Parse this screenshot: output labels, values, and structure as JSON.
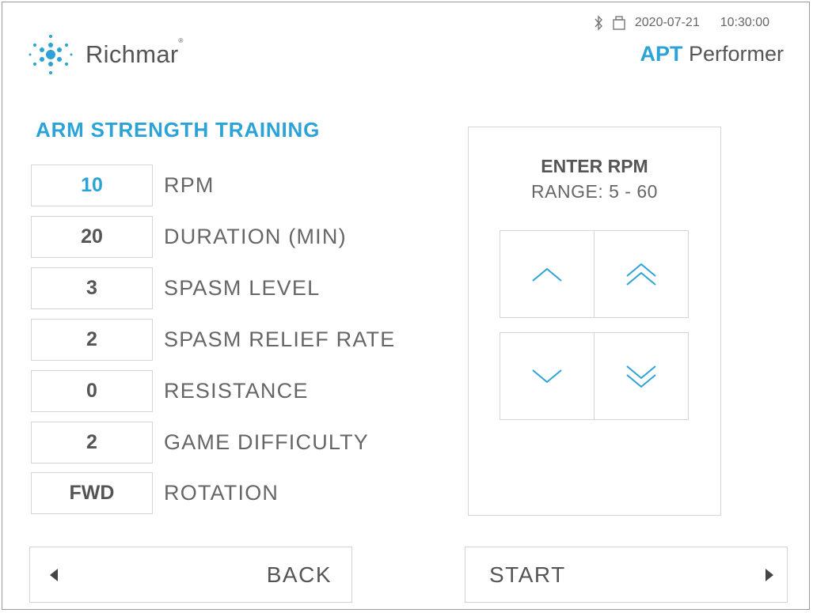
{
  "header": {
    "brand_name": "Richmar",
    "brand_mark": "®",
    "date": "2020-07-21",
    "time": "10:30:00",
    "product_prefix": "APT",
    "product_name": "Performer",
    "status_icons": [
      "bluetooth-icon",
      "usb-drive-icon"
    ]
  },
  "program": {
    "title": "ARM STRENGTH TRAINING",
    "params": [
      {
        "value": "10",
        "label": "RPM",
        "active": true
      },
      {
        "value": "20",
        "label": "DURATION (MIN)"
      },
      {
        "value": "3",
        "label": "SPASM LEVEL"
      },
      {
        "value": "2",
        "label": "SPASM RELIEF RATE"
      },
      {
        "value": "0",
        "label": "RESISTANCE"
      },
      {
        "value": "2",
        "label": "GAME DIFFICULTY"
      },
      {
        "value": "FWD",
        "label": "ROTATION"
      }
    ]
  },
  "rpm_panel": {
    "title": "ENTER RPM",
    "range": "RANGE: 5 - 60"
  },
  "footer": {
    "back_label": "BACK",
    "start_label": "START"
  },
  "colors": {
    "accent": "#2ca3d6",
    "text": "#555555",
    "border": "#d4d4d4"
  }
}
